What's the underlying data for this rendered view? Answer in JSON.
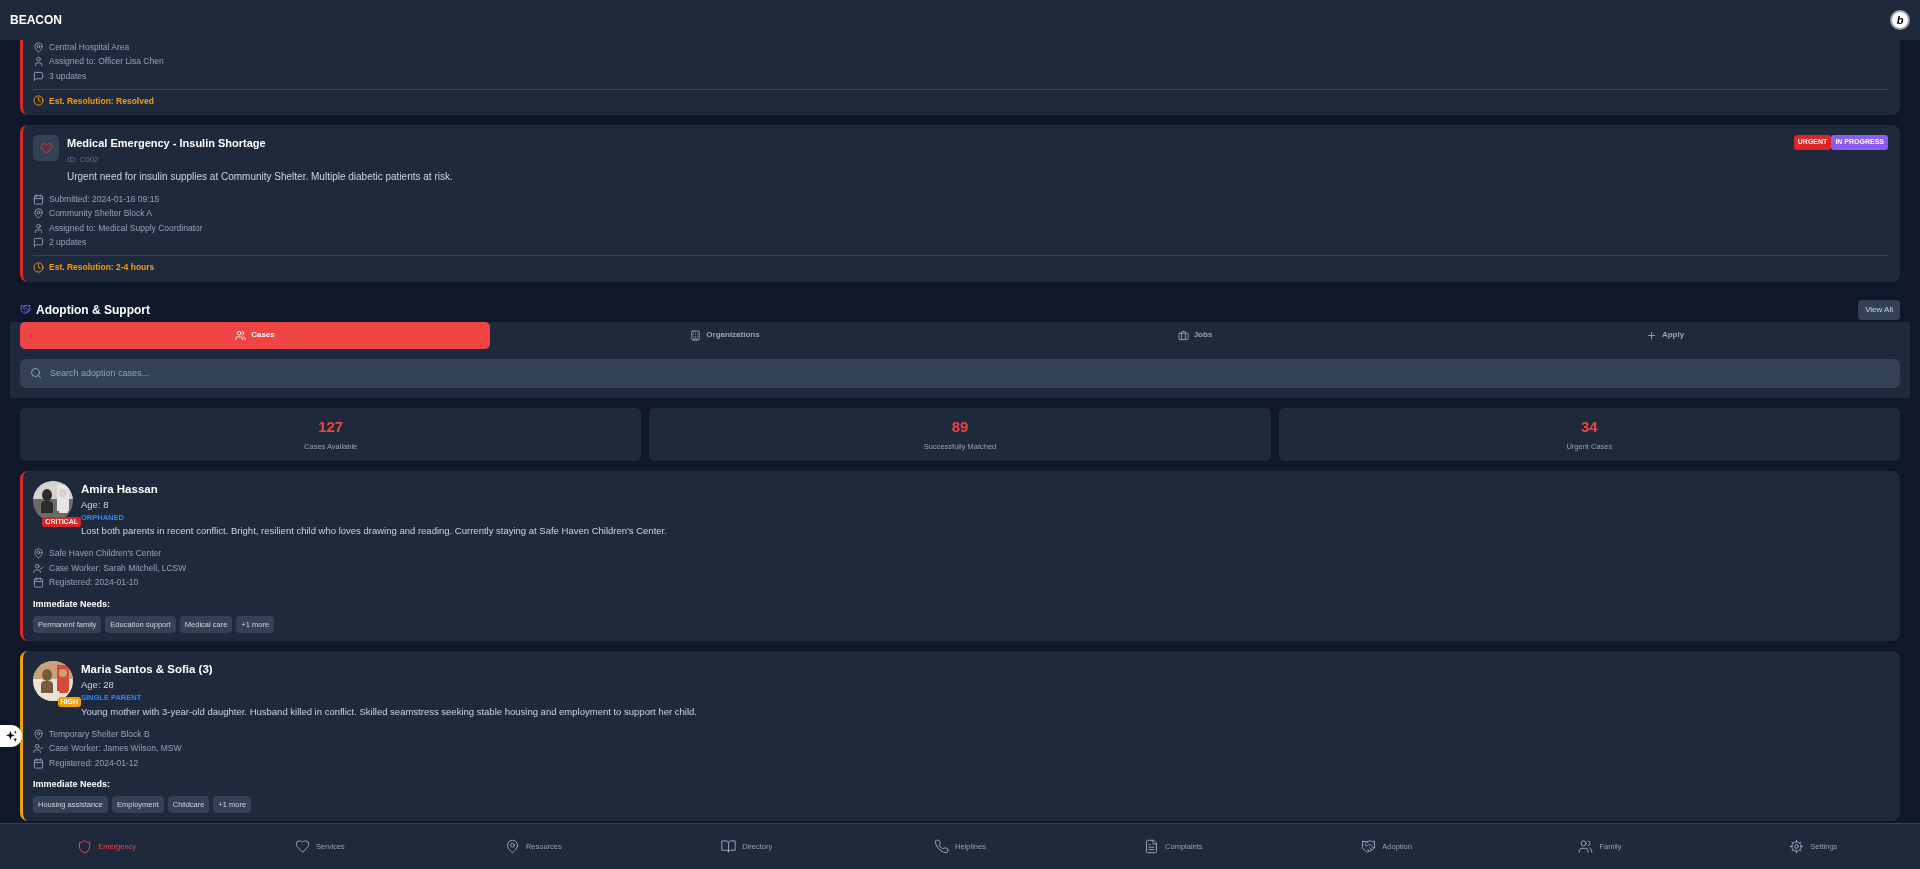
{
  "app": {
    "title": "BEACON",
    "user_badge": "b"
  },
  "complaints": [
    {
      "cut_top": true,
      "color": "#dc2626",
      "meta": [
        {
          "kind": "pin",
          "text": "Central Hospital Area"
        },
        {
          "kind": "user",
          "text": "Assigned to: Officer Lisa Chen"
        },
        {
          "kind": "chat",
          "text": "3 updates"
        }
      ],
      "resolution": "Est. Resolution: Resolved"
    },
    {
      "cut_top": false,
      "color": "#dc2626",
      "kind": "heart",
      "title": "Medical Emergency - Insulin Shortage",
      "id": "ID: C002",
      "description": "Urgent need for insulin supplies at Community Shelter. Multiple diabetic patients at risk.",
      "badges": [
        {
          "text": "URGENT",
          "color": "#dc2626"
        },
        {
          "text": "IN PROGRESS",
          "color": "#8b5cf6"
        }
      ],
      "meta": [
        {
          "kind": "calendar",
          "text": "Submitted: 2024-01-16 09:15"
        },
        {
          "kind": "pin",
          "text": "Community Shelter Block A"
        },
        {
          "kind": "user",
          "text": "Assigned to: Medical Supply Coordinator"
        },
        {
          "kind": "chat",
          "text": "2 updates"
        }
      ],
      "resolution": "Est. Resolution: 2-4 hours"
    }
  ],
  "adoption": {
    "title": "Adoption & Support",
    "view_all": "View All",
    "tabs": [
      {
        "label": "Cases",
        "kind": "users",
        "selected": true
      },
      {
        "label": "Organizations",
        "kind": "building",
        "selected": false
      },
      {
        "label": "Jobs",
        "kind": "briefcase",
        "selected": false
      },
      {
        "label": "Apply",
        "kind": "plus",
        "selected": false
      }
    ],
    "search": {
      "placeholder": "Search adoption cases..."
    },
    "stats": [
      {
        "value": "127",
        "label": "Cases Available"
      },
      {
        "value": "89",
        "label": "Successfully Matched"
      },
      {
        "value": "34",
        "label": "Urgent Cases"
      }
    ],
    "cases": [
      {
        "name": "Amira Hassan",
        "age": "Age: 8",
        "category": "ORPHANED",
        "priority": {
          "text": "CRITICAL",
          "color": "#dc2626"
        },
        "color": "#dc2626",
        "description": "Lost both parents in recent conflict. Bright, resilient child who loves drawing and reading. Currently staying at Safe Haven Children's Center.",
        "meta": [
          {
            "kind": "pin",
            "text": "Safe Haven Children's Center"
          },
          {
            "kind": "usercheck",
            "text": "Case Worker: Sarah Mitchell, LCSW"
          },
          {
            "kind": "calendar",
            "text": "Registered: 2024-01-10"
          }
        ],
        "needs_label": "Immediate Needs:",
        "needs": [
          "Permanent family",
          "Education support",
          "Medical care",
          "+1 more"
        ]
      },
      {
        "name": "Maria Santos & Sofia (3)",
        "age": "Age: 28",
        "category": "SINGLE PARENT",
        "priority": {
          "text": "HIGH",
          "color": "#f59e0b"
        },
        "color": "#f59e0b",
        "description": "Young mother with 3-year-old daughter. Husband killed in conflict. Skilled seamstress seeking stable housing and employment to support her child.",
        "meta": [
          {
            "kind": "pin",
            "text": "Temporary Shelter Block B"
          },
          {
            "kind": "usercheck",
            "text": "Case Worker: James Wilson, MSW"
          },
          {
            "kind": "calendar",
            "text": "Registered: 2024-01-12"
          }
        ],
        "needs_label": "Immediate Needs:",
        "needs": [
          "Housing assistance",
          "Employment",
          "Childcare",
          "+1 more"
        ]
      }
    ]
  },
  "nav": [
    {
      "label": "Emergency",
      "kind": "shield",
      "selected": true
    },
    {
      "label": "Services",
      "kind": "heart",
      "selected": false
    },
    {
      "label": "Resources",
      "kind": "pin",
      "selected": false
    },
    {
      "label": "Directory",
      "kind": "book",
      "selected": false
    },
    {
      "label": "Helplines",
      "kind": "phone",
      "selected": false
    },
    {
      "label": "Complaints",
      "kind": "file",
      "selected": false
    },
    {
      "label": "Adoption",
      "kind": "handshake",
      "selected": false
    },
    {
      "label": "Family",
      "kind": "users",
      "selected": false
    },
    {
      "label": "Settings",
      "kind": "gear",
      "selected": false
    }
  ]
}
